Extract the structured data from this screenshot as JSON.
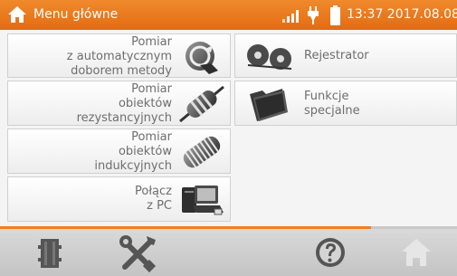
{
  "header": {
    "title": "Menu główne",
    "clock": "13:37 2017.08.08",
    "accent_color": "#e8761a"
  },
  "menu": {
    "auto_measure": {
      "lines": [
        "Pomiar",
        "z automatycznym",
        "doborem metody"
      ],
      "icon": "auto-method-icon"
    },
    "resistive": {
      "lines": [
        "Pomiar",
        "obiektów",
        "rezystancyjnych"
      ],
      "icon": "resistor-icon"
    },
    "inductive": {
      "lines": [
        "Pomiar",
        "obiektów",
        "indukcyjnych"
      ],
      "icon": "coil-icon"
    },
    "pc": {
      "lines": [
        "Połącz",
        "z PC"
      ],
      "icon": "computer-icon"
    },
    "recorder": {
      "lines": [
        "Rejestrator"
      ],
      "icon": "reels-icon"
    },
    "special": {
      "lines": [
        "Funkcje",
        "specjalne"
      ],
      "icon": "folder-icon"
    }
  },
  "bottom_bar": {
    "buttons": [
      "memory-icon",
      "settings-tools-icon",
      "help-icon",
      "home-icon"
    ]
  }
}
